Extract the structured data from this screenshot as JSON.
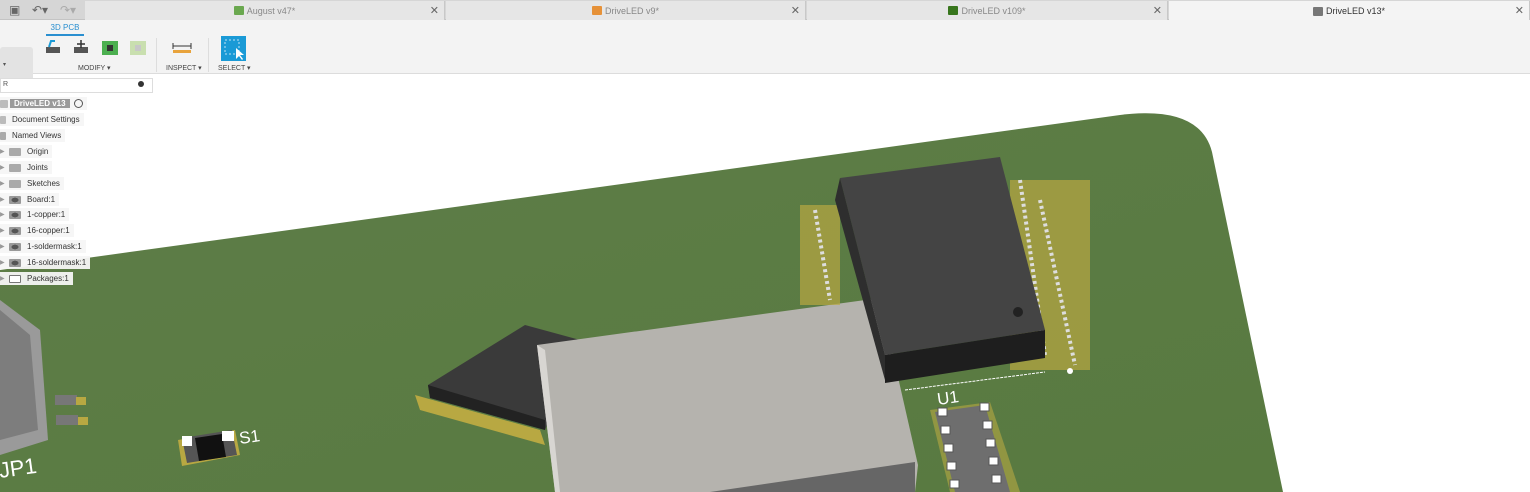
{
  "tabs": [
    {
      "label": "August v47*",
      "icon_color": "#6aa84f",
      "active": false
    },
    {
      "label": "DriveLED v9*",
      "icon_color": "#e69138",
      "active": false
    },
    {
      "label": "DriveLED v109*",
      "icon_color": "#38761d",
      "active": false
    },
    {
      "label": "DriveLED v13*",
      "icon_color": "#777777",
      "active": true
    }
  ],
  "quick_access": {
    "save_icon": "save-icon",
    "undo_icon": "undo-icon",
    "redo_icon": "redo-icon"
  },
  "toolbar": {
    "active_tab": "3D PCB",
    "modify_label": "MODIFY ▾",
    "inspect_label": "INSPECT ▾",
    "select_label": "SELECT ▾",
    "accent": "#1a9ad6"
  },
  "browser": {
    "header": "R",
    "root": "DriveLED v13",
    "items": [
      {
        "label": "Document Settings",
        "icon": "gear-icon"
      },
      {
        "label": "Named Views",
        "icon": "views-icon"
      },
      {
        "label": "Origin",
        "icon": "folder-icon"
      },
      {
        "label": "Joints",
        "icon": "folder-icon"
      },
      {
        "label": "Sketches",
        "icon": "folder-icon"
      },
      {
        "label": "Board:1",
        "icon": "layer-icon"
      },
      {
        "label": "1-copper:1",
        "icon": "layer-icon"
      },
      {
        "label": "16-copper:1",
        "icon": "layer-icon"
      },
      {
        "label": "1-soldermask:1",
        "icon": "layer-icon"
      },
      {
        "label": "16-soldermask:1",
        "icon": "layer-icon"
      },
      {
        "label": "Packages:1",
        "icon": "component-icon"
      }
    ]
  },
  "pcb": {
    "board_color": "#5b7a45",
    "labels": {
      "jp1": "JP1",
      "s1": "S1",
      "u1": "U1"
    }
  }
}
